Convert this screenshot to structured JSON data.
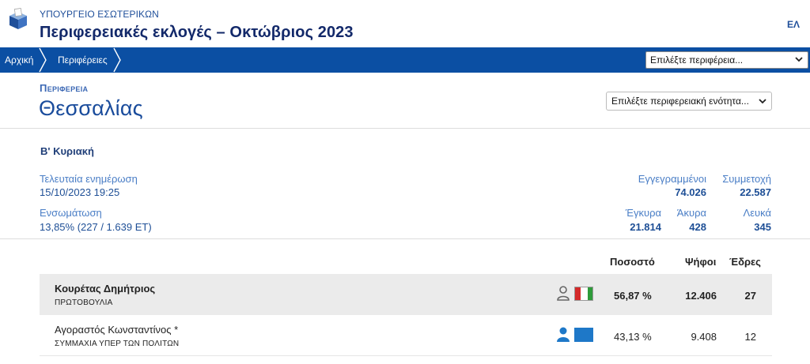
{
  "header": {
    "ministry": "ΥΠΟΥΡΓΕΙΟ ΕΣΩΤΕΡΙΚΩΝ",
    "title": "Περιφερειακές εκλογές – Οκτώβριος 2023",
    "lang": "ΕΛ",
    "logo_icon": "ballot-box-icon"
  },
  "nav": {
    "breadcrumbs": [
      "Αρχική",
      "Περιφέρειες"
    ],
    "region_select": "Επιλέξτε περιφέρεια...",
    "bar_color": "#0b4fa3"
  },
  "region": {
    "label": "Περιφερεια",
    "name": "Θεσσαλίας",
    "unit_select": "Επιλέξτε περιφερειακή ενότητα..."
  },
  "stats": {
    "round": "Β' Κυριακή",
    "last_update_label": "Τελευταία ενημέρωση",
    "last_update_value": "15/10/2023 19:25",
    "integration_label": "Ενσωμάτωση",
    "integration_value": "13,85% (227 / 1.639 ΕΤ)",
    "registered_label": "Εγγεγραμμένοι",
    "registered_value": "74.026",
    "turnout_label": "Συμμετοχή",
    "turnout_value": "22.587",
    "valid_label": "Έγκυρα",
    "valid_value": "21.814",
    "invalid_label": "Άκυρα",
    "invalid_value": "428",
    "blank_label": "Λευκά",
    "blank_value": "345"
  },
  "results": {
    "headers": {
      "percent": "Ποσοστό",
      "votes": "Ψήφοι",
      "seats": "Έδρες"
    },
    "rows": [
      {
        "candidate": "Κουρέτας Δημήτριος",
        "party": "ΠΡΩΤΟΒΟΥΛΙΑ",
        "percent": "56,87 %",
        "votes": "12.406",
        "seats": "27",
        "colors": [
          "#d42a2a",
          "#ffffff",
          "#2e9b3a"
        ]
      },
      {
        "candidate": "Αγοραστός Κωνσταντίνος *",
        "party": "ΣΥΜΜΑΧΙΑ ΥΠΕΡ ΤΩΝ ΠΟΛΙΤΩΝ",
        "percent": "43,13 %",
        "votes": "9.408",
        "seats": "12",
        "colors": [
          "#1e78c8"
        ]
      }
    ]
  }
}
